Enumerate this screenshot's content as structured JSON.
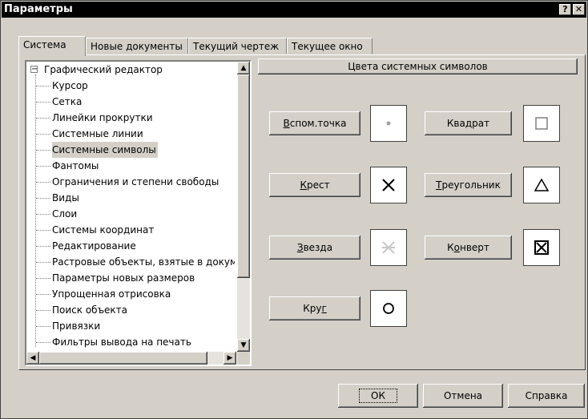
{
  "window": {
    "title": "Параметры",
    "help_glyph": "?",
    "close_glyph": "✕"
  },
  "tabs": [
    "Система",
    "Новые документы",
    "Текущий чертеж",
    "Текущее окно"
  ],
  "tree": {
    "root": "Графический редактор",
    "expander_glyph": "−",
    "items": [
      "Курсор",
      "Сетка",
      "Линейки прокрутки",
      "Системные линии",
      "Системные символы",
      "Фантомы",
      "Ограничения и степени свободы",
      "Виды",
      "Слои",
      "Системы координат",
      "Редактирование",
      "Растровые объекты, взятые в документ",
      "Параметры новых размеров",
      "Упрощенная отрисовка",
      "Поиск объекта",
      "Привязки",
      "Фильтры вывода на печать"
    ],
    "selected_item": "Системные символы"
  },
  "panel": {
    "header": "Цвета системных символов",
    "symbols": [
      {
        "label": "Вспом.точка",
        "mnemonic": "В",
        "icon": "dot-icon"
      },
      {
        "label": "Квадрат",
        "mnemonic": "д",
        "icon": "square-icon"
      },
      {
        "label": "Крест",
        "mnemonic": "К",
        "icon": "cross-icon"
      },
      {
        "label": "Треугольник",
        "mnemonic": "Т",
        "icon": "triangle-icon"
      },
      {
        "label": "Звезда",
        "mnemonic": "З",
        "icon": "star-icon"
      },
      {
        "label": "Конверт",
        "mnemonic": "о",
        "icon": "envelope-icon"
      },
      {
        "label": "Круг",
        "mnemonic": "г",
        "icon": "circle-icon"
      }
    ]
  },
  "footer": {
    "ok": "ОК",
    "cancel": "Отмена",
    "help": "Справка"
  },
  "colors": {
    "title_bg": "#000000",
    "face": "#d4d0c8",
    "selected_bg": "#d4d0c8",
    "dot": "#a0a0a0",
    "star": "#c8c8c8"
  }
}
